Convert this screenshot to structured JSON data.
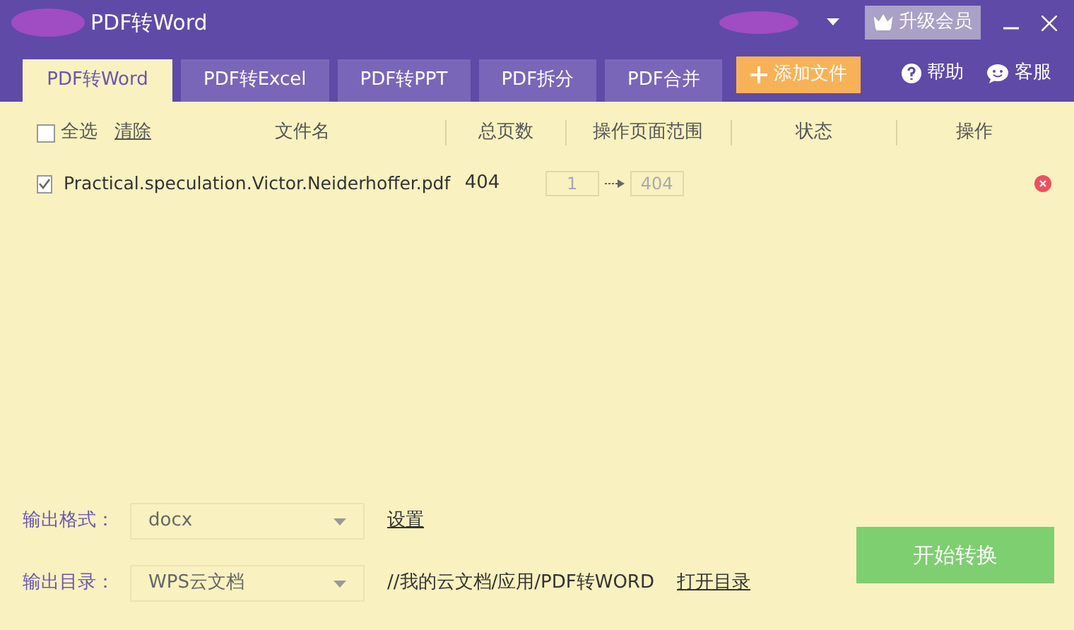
{
  "window": {
    "title": "PDF转Word",
    "upgrade_button": "升级会员"
  },
  "tabs": [
    {
      "label": "PDF转Word",
      "selected": true
    },
    {
      "label": "PDF转Excel",
      "selected": false
    },
    {
      "label": "PDF转PPT",
      "selected": false
    },
    {
      "label": "PDF拆分",
      "selected": false
    },
    {
      "label": "PDF合并",
      "selected": false
    }
  ],
  "add_file_button": "添加文件",
  "help_links": [
    {
      "kind": "help",
      "label": "帮助"
    },
    {
      "kind": "service",
      "label": "客服"
    }
  ],
  "table": {
    "select_all": {
      "label": "全选",
      "checked": false
    },
    "clear_link": "清除",
    "columns": [
      "文件名",
      "总页数",
      "操作页面范围",
      "状态",
      "操作"
    ],
    "rows": [
      {
        "checked": true,
        "file": "Practical.speculation.Victor.Neiderhoffer.pdf",
        "pages": "404",
        "range_from": "1",
        "range_to": "404"
      }
    ]
  },
  "output": {
    "format_label": "输出格式：",
    "format_value": "docx",
    "settings_link": "设置",
    "dir_label": "输出目录：",
    "dir_value": "WPS云文档",
    "dir_path": "//我的云文档/应用/PDF转WORD",
    "open_dir_link": "打开目录"
  },
  "start_button": "开始转换"
}
